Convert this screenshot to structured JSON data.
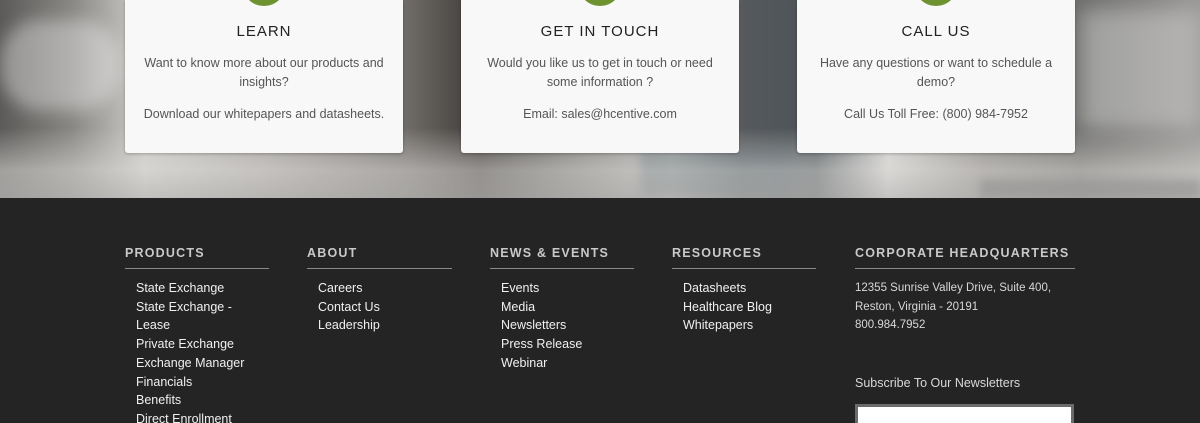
{
  "cards": [
    {
      "title": "LEARN",
      "description": "Want to know more about our products and insights?",
      "extra": "Download our whitepapers and datasheets."
    },
    {
      "title": "GET IN TOUCH",
      "description": "Would you like us to get in touch or need some information ?",
      "extra": "Email: sales@hcentive.com"
    },
    {
      "title": "CALL US",
      "description": "Have any questions or want to schedule a demo?",
      "extra": "Call Us Toll Free: (800) 984-7952"
    }
  ],
  "footer": {
    "products": {
      "heading": "PRODUCTS",
      "links": [
        "State Exchange",
        "State Exchange - Lease",
        "Private Exchange",
        "Exchange Manager",
        "Financials",
        "Benefits",
        "Direct Enrollment"
      ]
    },
    "about": {
      "heading": "ABOUT",
      "links": [
        "Careers",
        "Contact Us",
        "Leadership"
      ]
    },
    "news": {
      "heading": "NEWS & EVENTS",
      "links": [
        "Events",
        "Media",
        "Newsletters",
        "Press Release",
        "Webinar"
      ]
    },
    "resources": {
      "heading": "RESOURCES",
      "links": [
        "Datasheets",
        "Healthcare Blog",
        "Whitepapers"
      ]
    },
    "hq": {
      "heading": "CORPORATE HEADQUARTERS",
      "address_line1": "12355 Sunrise Valley Drive, Suite 400,",
      "address_line2": "Reston, Virginia - 20191",
      "phone": "800.984.7952"
    },
    "subscribe_label": "Subscribe To Our Newsletters"
  },
  "colors": {
    "accent_green": "#6e9132",
    "footer_bg": "#242424",
    "card_bg": "#f8f8f8"
  }
}
